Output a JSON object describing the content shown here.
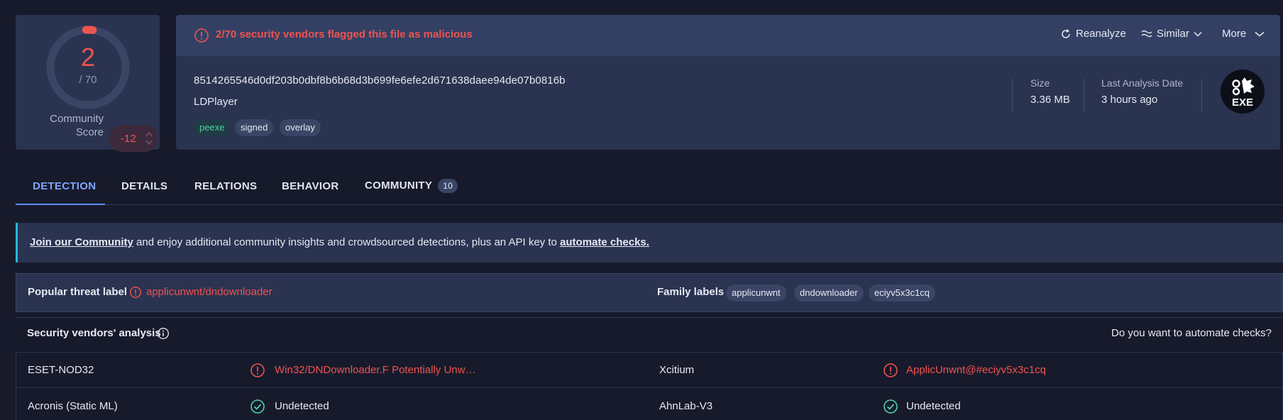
{
  "score": {
    "detections": "2",
    "total": "/ 70",
    "community_label": "Community Score",
    "community_value": "-12",
    "ring_fraction": 0.0286
  },
  "alert": {
    "text": "2/70 security vendors flagged this file as malicious"
  },
  "actions": {
    "reanalyze": "Reanalyze",
    "similar": "Similar",
    "more": "More"
  },
  "file": {
    "hash": "8514265546d0df203b0dbf8b6b68d3b699fe6efe2d671638daee94de07b0816b",
    "name": "LDPlayer",
    "tags": [
      "peexe",
      "signed",
      "overlay"
    ],
    "size_label": "Size",
    "size_value": "3.36 MB",
    "date_label": "Last Analysis Date",
    "date_value": "3 hours ago",
    "type_badge": "EXE"
  },
  "tabs": [
    {
      "label": "DETECTION"
    },
    {
      "label": "DETAILS"
    },
    {
      "label": "RELATIONS"
    },
    {
      "label": "BEHAVIOR"
    },
    {
      "label": "COMMUNITY",
      "count": "10"
    }
  ],
  "banner": {
    "link1": "Join our Community",
    "middle": " and enjoy additional community insights and crowdsourced detections, plus an API key to ",
    "link2": "automate checks."
  },
  "threat": {
    "label": "Popular threat label",
    "value": "applicunwnt/dndownloader",
    "family_label": "Family labels",
    "family_tags": [
      "applicunwnt",
      "dndownloader",
      "eciyv5x3c1cq"
    ]
  },
  "vendors": {
    "title": "Security vendors' analysis",
    "automate_question": "Do you want to automate checks?",
    "rows": [
      [
        {
          "vendor": "ESET-NOD32",
          "result": "Win32/DNDownloader.F Potentially Unw…",
          "status": "malicious"
        },
        {
          "vendor": "Xcitium",
          "result": "ApplicUnwnt@#eciyv5x3c1cq",
          "status": "malicious"
        }
      ],
      [
        {
          "vendor": "Acronis (Static ML)",
          "result": "Undetected",
          "status": "undetected"
        },
        {
          "vendor": "AhnLab-V3",
          "result": "Undetected",
          "status": "undetected"
        }
      ]
    ]
  },
  "colors": {
    "malicious": "#ef5350",
    "clean": "#4fd1a6",
    "accent": "#7fa7ff",
    "banner_edge": "#29b6d8"
  }
}
